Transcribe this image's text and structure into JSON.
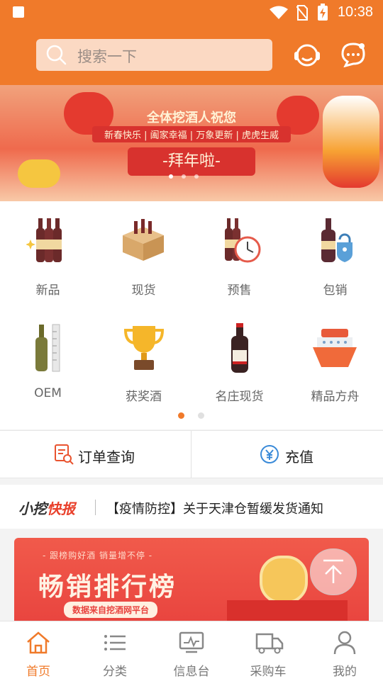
{
  "status_bar": {
    "time": "10:38"
  },
  "header": {
    "search_placeholder": "搜索一下"
  },
  "banner": {
    "line1": "全体挖酒人祝您",
    "line2": "新春快乐 | 阖家幸福 | 万象更新 | 虎虎生威",
    "line3": "-拜年啦-"
  },
  "categories": [
    {
      "label": "新品",
      "icon": "wine-bottles-icon"
    },
    {
      "label": "现货",
      "icon": "wine-box-icon"
    },
    {
      "label": "预售",
      "icon": "bottles-clock-icon"
    },
    {
      "label": "包销",
      "icon": "bottle-lock-icon"
    },
    {
      "label": "OEM",
      "icon": "bottle-ruler-icon"
    },
    {
      "label": "获奖酒",
      "icon": "trophy-icon"
    },
    {
      "label": "名庄现货",
      "icon": "chateau-bottle-icon"
    },
    {
      "label": "精品方舟",
      "icon": "ship-icon"
    }
  ],
  "quick_actions": {
    "order_query": "订单查询",
    "recharge": "充值"
  },
  "news": {
    "brand_prefix": "小挖",
    "brand_suffix": "快报",
    "headline": "【疫情防控】关于天津仓暂缓发货通知"
  },
  "promo": {
    "subtitle": "- 跟榜购好酒  销量增不停 -",
    "title": "畅销排行榜",
    "source": "数据来自挖酒网平台"
  },
  "bottom_nav": [
    {
      "label": "首页",
      "active": true
    },
    {
      "label": "分类",
      "active": false
    },
    {
      "label": "信息台",
      "active": false
    },
    {
      "label": "采购车",
      "active": false
    },
    {
      "label": "我的",
      "active": false
    }
  ],
  "colors": {
    "brand_orange": "#f07a2a",
    "promo_red": "#e8433e"
  }
}
